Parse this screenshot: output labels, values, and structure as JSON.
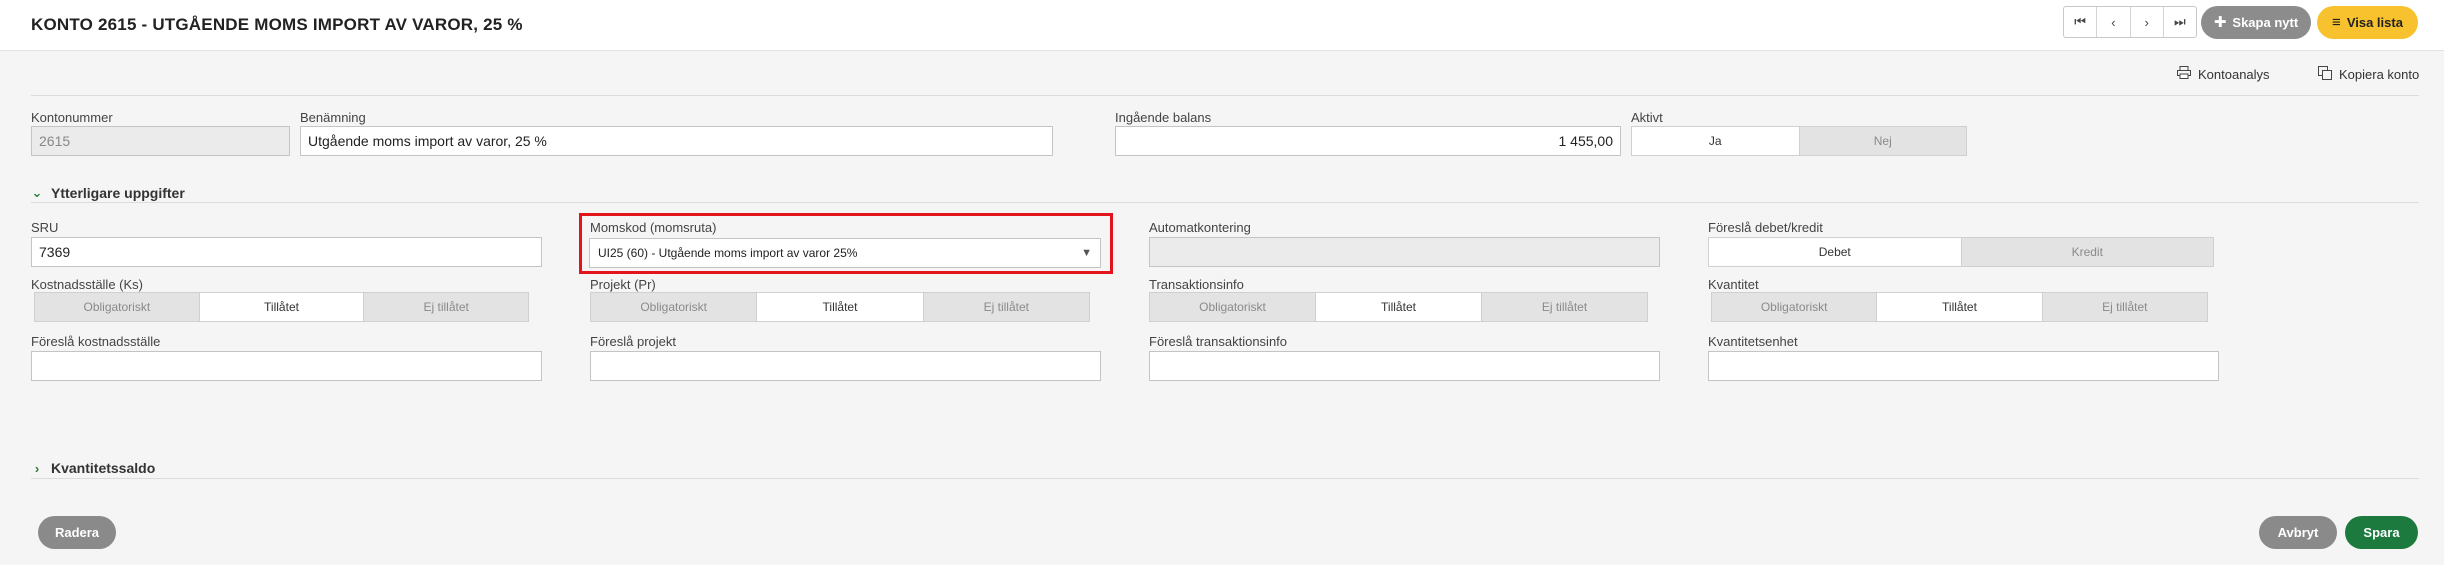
{
  "header": {
    "title": "KONTO 2615 - UTGÅENDE MOMS IMPORT AV VAROR, 25 %",
    "nav": {
      "first": "⏮",
      "prev": "‹",
      "next": "›",
      "last": "⏭"
    },
    "create_label": "Skapa nytt",
    "create_icon": "plus-icon",
    "list_label": "Visa lista",
    "list_icon": "list-icon"
  },
  "actions": {
    "kontoanalys": "Kontoanalys",
    "kontoanalys_icon": "printer-icon",
    "kopiera": "Kopiera konto",
    "kopiera_icon": "copy-icon"
  },
  "account": {
    "kontonummer_label": "Kontonummer",
    "kontonummer_value": "2615",
    "benamning_label": "Benämning",
    "benamning_value": "Utgående moms import av varor, 25 %",
    "ingaende_label": "Ingående balans",
    "ingaende_value": "1 455,00",
    "aktivt_label": "Aktivt",
    "aktivt_options": [
      "Ja",
      "Nej"
    ],
    "aktivt_selected": "Ja"
  },
  "sections": {
    "ytterligare": "Ytterligare uppgifter",
    "kvantitetssaldo": "Kvantitetssaldo"
  },
  "details": {
    "sru_label": "SRU",
    "sru_value": "7369",
    "momskod_label": "Momskod (momsruta)",
    "momskod_value": "UI25 (60) - Utgående moms import av varor 25%",
    "automat_label": "Automatkontering",
    "automat_value": "",
    "debkred_label": "Föreslå debet/kredit",
    "debkred_options": [
      "Debet",
      "Kredit"
    ],
    "debkred_selected": "Debet",
    "ks_label": "Kostnadsställe (Ks)",
    "pr_label": "Projekt (Pr)",
    "trans_label": "Transaktionsinfo",
    "kvant_label": "Kvantitet",
    "permission_options": [
      "Obligatoriskt",
      "Tillåtet",
      "Ej tillåtet"
    ],
    "permission_selected": "Tillåtet",
    "foresla_ks_label": "Föreslå kostnadsställe",
    "foresla_ks_value": "",
    "foresla_pr_label": "Föreslå projekt",
    "foresla_pr_value": "",
    "foresla_trans_label": "Föreslå transaktionsinfo",
    "foresla_trans_value": "",
    "kvantenhet_label": "Kvantitetsenhet",
    "kvantenhet_value": ""
  },
  "footer": {
    "delete_label": "Radera",
    "cancel_label": "Avbryt",
    "save_label": "Spara"
  },
  "colors": {
    "primary_yellow": "#f7c22d",
    "save_green": "#1c7a3e",
    "neutral_button": "#8a8a8a",
    "highlight_red": "#e2141c"
  }
}
